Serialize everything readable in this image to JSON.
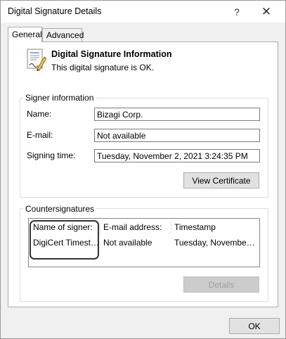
{
  "window": {
    "title": "Digital Signature Details"
  },
  "titlebar": {
    "help_glyph": "?",
    "close_glyph": "✕"
  },
  "tabs": [
    {
      "label": "General",
      "selected": true
    },
    {
      "label": "Advanced",
      "selected": false
    }
  ],
  "info": {
    "title": "Digital Signature Information",
    "status": "This digital signature is OK."
  },
  "signer": {
    "legend": "Signer information",
    "name_label": "Name:",
    "name_value": "Bizagi Corp.",
    "email_label": "E-mail:",
    "email_value": "Not available",
    "time_label": "Signing time:",
    "time_value": "Tuesday, November 2, 2021 3:24:35 PM",
    "view_cert_button": "View Certificate"
  },
  "countersignatures": {
    "legend": "Countersignatures",
    "columns": [
      "Name of signer:",
      "E-mail address:",
      "Timestamp"
    ],
    "rows": [
      [
        "DigiCert Timesta...",
        "Not available",
        "Tuesday, November ..."
      ]
    ],
    "details_button": "Details"
  },
  "footer": {
    "ok_button": "OK"
  },
  "colors": {
    "highlight_border": "#333333",
    "window_bg": "#f0f0f0",
    "panel_bg": "#ffffff"
  }
}
